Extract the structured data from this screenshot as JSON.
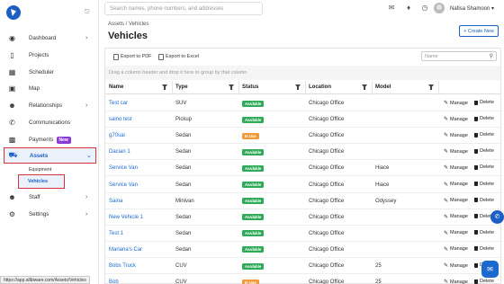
{
  "sidebar": {
    "items": [
      {
        "label": "Dashboard",
        "icon": "gauge-icon"
      },
      {
        "label": "Projects",
        "icon": "folder-icon"
      },
      {
        "label": "Scheduler",
        "icon": "calendar-icon"
      },
      {
        "label": "Map",
        "icon": "map-icon"
      },
      {
        "label": "Relationships",
        "icon": "people-icon"
      },
      {
        "label": "Communications",
        "icon": "phone-icon"
      },
      {
        "label": "Payments",
        "icon": "wallet-icon",
        "badge": "New"
      },
      {
        "label": "Assets",
        "icon": "truck-icon"
      },
      {
        "label": "Staff",
        "icon": "users-icon"
      },
      {
        "label": "Settings",
        "icon": "gear-icon"
      }
    ],
    "sub_items": [
      "Equipment",
      "Vehicles"
    ]
  },
  "status_url": "https://app.allbiware.com/Assets/Vehicles",
  "topbar": {
    "search_placeholder": "Search names, phone numbers, and addresses",
    "user_name": "Nafisa Shamoon"
  },
  "page": {
    "breadcrumb": "Assets / Vehicles",
    "title": "Vehicles",
    "create_label": "+ Create New"
  },
  "toolbar": {
    "export_pdf": "Export to PDF",
    "export_excel": "Export to Excel",
    "search_placeholder": "Name",
    "group_hint": "Drag a column header and drop it here to group by that column"
  },
  "columns": [
    "Name",
    "Type",
    "Status",
    "Location",
    "Model"
  ],
  "row_actions": {
    "manage": "Manage",
    "delete": "Delete"
  },
  "colors": {
    "accent": "#1b5fc4",
    "available": "#2eaa58",
    "in_use": "#f09a3b",
    "highlight": "#d9333b"
  },
  "rows": [
    {
      "name": "Test car",
      "type": "SUV",
      "status": "Available",
      "status_kind": "green",
      "location": "Chicago Office",
      "model": ""
    },
    {
      "name": "saino test",
      "type": "Pickup",
      "status": "Available",
      "status_kind": "green",
      "location": "Chicago Office",
      "model": ""
    },
    {
      "name": "g70sai",
      "type": "Sedan",
      "status": "In Use",
      "status_kind": "orange",
      "location": "Chicago Office",
      "model": ""
    },
    {
      "name": "Dacian 1",
      "type": "Sedan",
      "status": "Available",
      "status_kind": "green",
      "location": "Chicago Office",
      "model": ""
    },
    {
      "name": "Service Van",
      "type": "Sedan",
      "status": "Available",
      "status_kind": "green",
      "location": "Chicago Office",
      "model": "Hiace"
    },
    {
      "name": "Service Van",
      "type": "Sedan",
      "status": "Available",
      "status_kind": "green",
      "location": "Chicago Office",
      "model": "Hiace"
    },
    {
      "name": "Saina",
      "type": "Minivan",
      "status": "Available",
      "status_kind": "green",
      "location": "Chicago Office",
      "model": "Odyssey"
    },
    {
      "name": "New Vehicle 1",
      "type": "Sedan",
      "status": "Available",
      "status_kind": "green",
      "location": "Chicago Office",
      "model": ""
    },
    {
      "name": "Test 1",
      "type": "Sedan",
      "status": "Available",
      "status_kind": "green",
      "location": "Chicago Office",
      "model": ""
    },
    {
      "name": "Mariana's Car",
      "type": "Sedan",
      "status": "Available",
      "status_kind": "green",
      "location": "Chicago Office",
      "model": ""
    },
    {
      "name": "Bobs Truck",
      "type": "CUV",
      "status": "Available",
      "status_kind": "green",
      "location": "Chicago Office",
      "model": "25"
    },
    {
      "name": "Bob",
      "type": "CUV",
      "status": "In Use",
      "status_kind": "orange",
      "location": "Chicago Office",
      "model": "25"
    }
  ]
}
